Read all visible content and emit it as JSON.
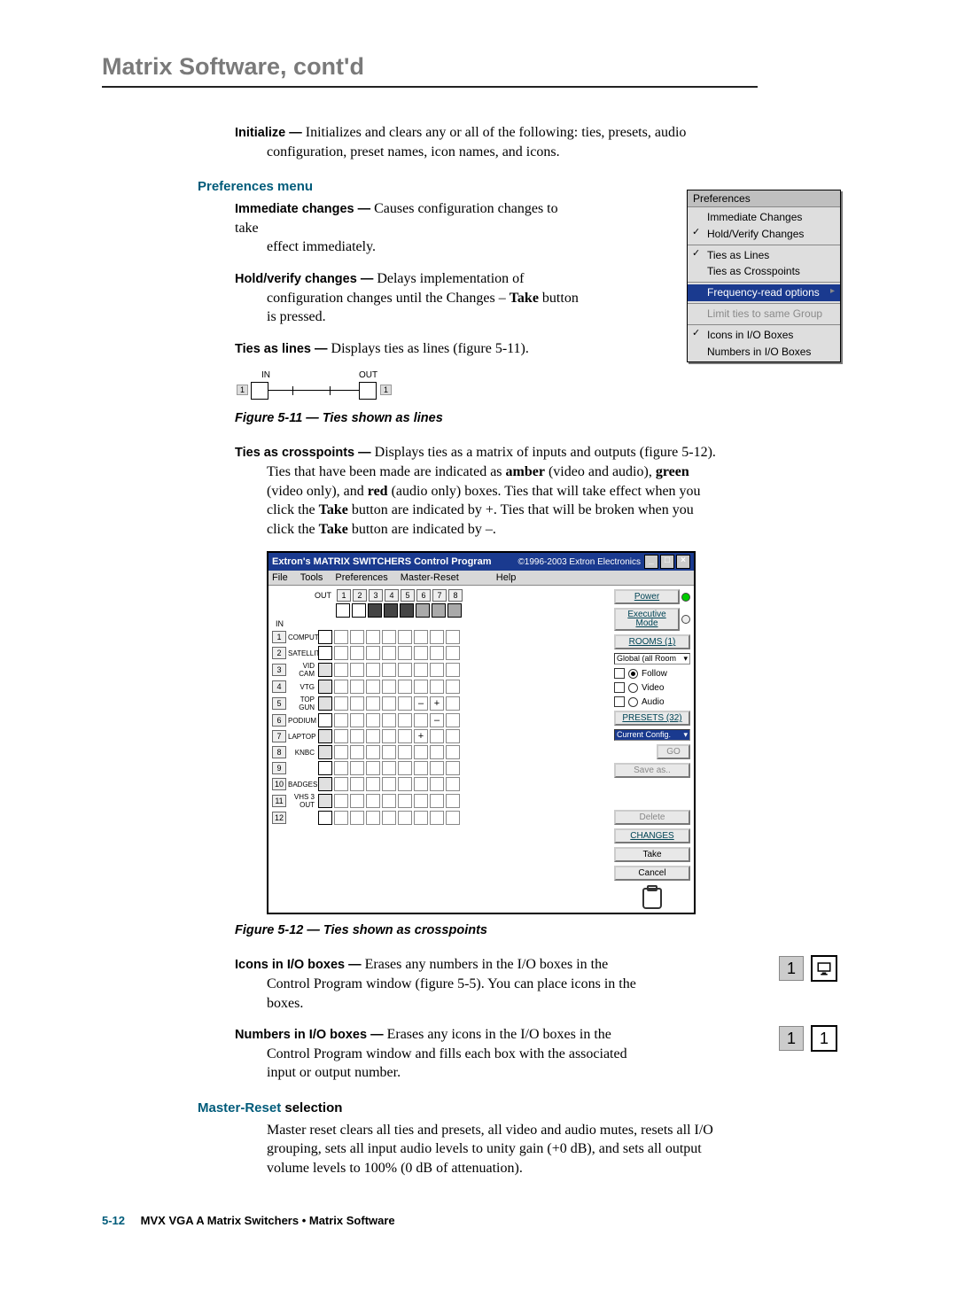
{
  "chapter_title": "Matrix Software, cont'd",
  "initialize": {
    "term": "Initialize —",
    "desc_lead": " Initializes and clears any or all of the following: ties, presets, audio",
    "desc_cont": "configuration, preset names, icon names, and icons."
  },
  "prefs_heading": "Preferences menu",
  "imm": {
    "term": "Immediate changes —",
    "desc_lead": " Causes configuration changes to take",
    "desc_cont": "effect immediately."
  },
  "hv": {
    "term": "Hold/verify changes —",
    "desc_lead": " Delays implementation of",
    "desc_cont1": "configuration changes until the Changes – ",
    "take_word": "Take",
    "desc_cont2": " button is pressed."
  },
  "ties_lines": {
    "term": "Ties as lines —",
    "desc_lead": " Displays ties as lines (figure 5-11)."
  },
  "mini": {
    "in": "IN",
    "out": "OUT",
    "one_a": "1",
    "one_b": "1"
  },
  "caption_511": "Figure 5-11 — Ties shown as lines",
  "ties_cross": {
    "term": "Ties as crosspoints —",
    "desc_lead": " Displays ties as a matrix of inputs and outputs (figure 5-12).",
    "l2a": "Ties that have been made are indicated as ",
    "amber": "amber",
    "l2b": " (video and audio), ",
    "green": "green",
    "l3a": "(video only), and ",
    "red": "red",
    "l3b": " (audio only) boxes.  Ties that will take effect when you",
    "l4a": "click the ",
    "take1": "Take",
    "l4b": " button are indicated by +.  Ties that will be broken when you",
    "l5a": "click the ",
    "take2": "Take",
    "l5b": " button are indicated by –."
  },
  "app": {
    "title": "Extron's MATRIX SWITCHERS Control Program",
    "copyright": "©1996-2003 Extron Electronics",
    "winbtns": [
      "_",
      "□",
      "×"
    ],
    "menus": [
      "File",
      "Tools",
      "Preferences",
      "Master-Reset",
      "Help"
    ],
    "out_label": "OUT",
    "in_label": "IN",
    "out_nums": [
      "1",
      "2",
      "3",
      "4",
      "5",
      "6",
      "7",
      "8"
    ],
    "in_rows": [
      {
        "n": "1",
        "name": "COMPUTER",
        "icon": ""
      },
      {
        "n": "2",
        "name": "SATELLITE",
        "icon": ""
      },
      {
        "n": "3",
        "name": "VID CAM",
        "icon": "cam"
      },
      {
        "n": "4",
        "name": "VTG",
        "icon": "txt"
      },
      {
        "n": "5",
        "name": "TOP GUN",
        "icon": "movie"
      },
      {
        "n": "6",
        "name": "PODIUM",
        "icon": ""
      },
      {
        "n": "7",
        "name": "LAPTOP",
        "icon": "pc"
      },
      {
        "n": "8",
        "name": "KNBC",
        "icon": "tick"
      },
      {
        "n": "9",
        "name": "",
        "icon": ""
      },
      {
        "n": "10",
        "name": "BADGES",
        "icon": "doc"
      },
      {
        "n": "11",
        "name": "VHS 3 OUT",
        "icon": "vcr"
      },
      {
        "n": "12",
        "name": "",
        "icon": ""
      }
    ],
    "marks": {
      "r5c6": "–",
      "r5c7": "+",
      "r6c7": "–",
      "r7c6": "+"
    },
    "panel": {
      "power": "Power",
      "exec1": "Executive",
      "exec2": "Mode",
      "rooms": "ROOMS (1)",
      "global_sel": "Global (all Room",
      "follow": "Follow",
      "video": "Video",
      "audio": "Audio",
      "presets": "PRESETS (32)",
      "cur_sel": "Current Config.",
      "go": "GO",
      "saveas": "Save as..",
      "delete": "Delete",
      "changes": "CHANGES",
      "take": "Take",
      "cancel": "Cancel"
    }
  },
  "caption_512": "Figure 5-12 — Ties shown as crosspoints",
  "icons_io": {
    "term": "Icons in I/O boxes —",
    "desc_lead": " Erases any numbers in the I/O boxes in the",
    "l2": "Control Program window (figure 5-5).  You can place icons in the",
    "l3": "boxes."
  },
  "numbers_io": {
    "term": "Numbers in I/O boxes —",
    "desc_lead": " Erases any icons in the I/O boxes in the",
    "l2": "Control Program window and fills each box with the associated",
    "l3": "input or output number."
  },
  "side1": {
    "num": "1"
  },
  "side2": {
    "numa": "1",
    "numb": "1"
  },
  "mr_head_blue": "Master-Reset ",
  "mr_head_black": "selection",
  "mr_body1": "Master reset clears all ties and presets, all video and audio mutes, resets all I/O",
  "mr_body2": "grouping, sets all input audio levels to unity gain (+0 dB), and sets all output",
  "mr_body3": "volume levels to 100% (0 dB of attenuation).",
  "prefs_dd": {
    "hdr": "Preferences",
    "items": [
      "Immediate Changes",
      "Hold/Verify Changes",
      "Ties as Lines",
      "Ties as Crosspoints",
      "Frequency-read options",
      "Limit ties to same Group",
      "Icons in I/O Boxes",
      "Numbers in I/O Boxes"
    ]
  },
  "footer": {
    "pagenum": "5-12",
    "breadcrumb": "MVX VGA A Matrix Switchers • Matrix Software"
  }
}
